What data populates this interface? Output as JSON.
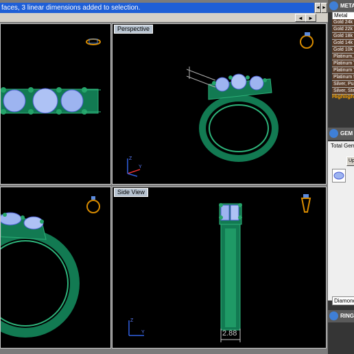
{
  "status": {
    "message": "faces, 3 linear dimensions added to selection."
  },
  "nav": {
    "left": "◄",
    "right": "►"
  },
  "viewports": {
    "perspective": {
      "title": "Perspective",
      "axis_z": "Z",
      "axis_y": "Y"
    },
    "side": {
      "title": "Side View",
      "axis_z": "Z",
      "axis_y": "Y",
      "dimension": "2.88"
    },
    "bottom_left": {
      "axis_z": "Z"
    }
  },
  "panel": {
    "metal_title": "METAL",
    "metal_header": "Metal",
    "metals": [
      "Gold 24k",
      "Gold 22k",
      "Gold 18k",
      "Gold 14k",
      "Gold 10k",
      "Platinum, ...",
      "Platinum T...",
      "Platinum T...",
      "Platinum 5...",
      "Silver, Pur...",
      "Silver, Ste..."
    ],
    "highlight": "Highlight",
    "gem_title": "GEM",
    "total_gems": "Total Gem",
    "up_button": "Up",
    "diamond": "Diamond",
    "ring_title": "RING"
  },
  "colors": {
    "ring": "#1f8a5f",
    "gem": "#9db4f0",
    "prong": "#1f8a5f",
    "dimension": "#c8c8c8"
  }
}
